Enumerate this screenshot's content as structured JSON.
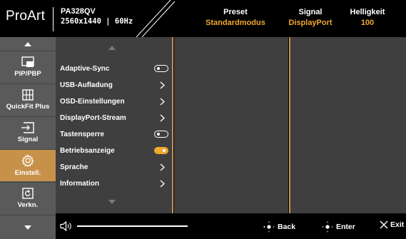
{
  "header": {
    "logo": "ProArt",
    "model": "PA328QV",
    "resolution": "2560x1440",
    "refresh": "60Hz",
    "stats": [
      {
        "label": "Preset",
        "value": "Standardmodus"
      },
      {
        "label": "Signal",
        "value": "DisplayPort"
      },
      {
        "label": "Helligkeit",
        "value": "100"
      }
    ]
  },
  "sidebar": {
    "items": [
      {
        "label": "PIP/PBP",
        "icon": "pip-icon"
      },
      {
        "label": "QuickFit Plus",
        "icon": "grid-icon"
      },
      {
        "label": "Signal",
        "icon": "input-icon"
      },
      {
        "label": "Einstell.",
        "icon": "gear-icon",
        "active": true
      },
      {
        "label": "Verkn.",
        "icon": "shortcut-icon"
      }
    ]
  },
  "menu": {
    "items": [
      {
        "label": "Adaptive-Sync",
        "control": "toggle",
        "state": "off"
      },
      {
        "label": "USB-Aufladung",
        "control": "chevron"
      },
      {
        "label": "OSD-Einstellungen",
        "control": "chevron"
      },
      {
        "label": "DisplayPort-Stream",
        "control": "chevron"
      },
      {
        "label": "Tastensperre",
        "control": "toggle",
        "state": "off"
      },
      {
        "label": "Betriebsanzeige",
        "control": "toggle",
        "state": "on"
      },
      {
        "label": "Sprache",
        "control": "chevron"
      },
      {
        "label": "Information",
        "control": "chevron"
      }
    ]
  },
  "footer": {
    "volume_icon": "speaker-icon",
    "back_label": "Back",
    "enter_label": "Enter",
    "exit_label": "Exit"
  },
  "colors": {
    "accent": "#c8914a",
    "highlight_text": "#f0a830",
    "panel": "#3f3f3f",
    "sidebar": "#5a5a5a"
  }
}
